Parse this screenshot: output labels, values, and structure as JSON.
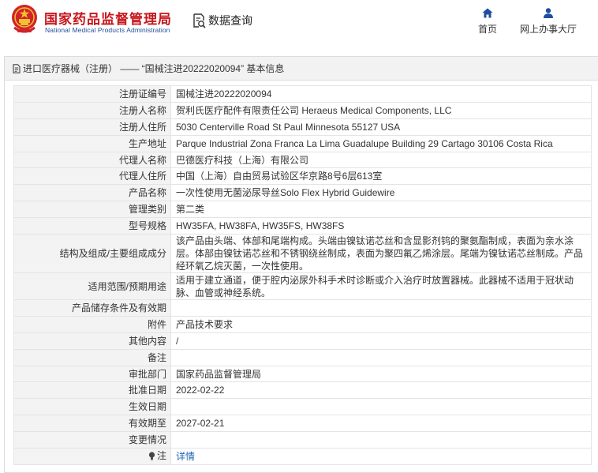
{
  "header": {
    "logo_cn": "国家药品监督管理局",
    "logo_en": "National Medical Products Administration",
    "search_label": "数据查询",
    "nav": [
      {
        "label": "首页",
        "icon": "home-icon"
      },
      {
        "label": "网上办事大厅",
        "icon": "user-icon"
      }
    ]
  },
  "panel": {
    "title": "进口医疗器械（注册） —— “国械注进20222020094” 基本信息",
    "rows": [
      {
        "label": "注册证编号",
        "value": "国械注进20222020094"
      },
      {
        "label": "注册人名称",
        "value": "贺利氏医疗配件有限责任公司 Heraeus Medical Components, LLC"
      },
      {
        "label": "注册人住所",
        "value": "5030 Centerville Road St Paul Minnesota 55127 USA"
      },
      {
        "label": "生产地址",
        "value": "Parque Industrial Zona Franca La Lima Guadalupe Building 29 Cartago 30106 Costa Rica"
      },
      {
        "label": "代理人名称",
        "value": "巴德医疗科技（上海）有限公司"
      },
      {
        "label": "代理人住所",
        "value": "中国（上海）自由贸易试验区华京路8号6层613室"
      },
      {
        "label": "产品名称",
        "value": "一次性使用无菌泌尿导丝Solo Flex Hybrid Guidewire"
      },
      {
        "label": "管理类别",
        "value": "第二类"
      },
      {
        "label": "型号规格",
        "value": "HW35FA, HW38FA, HW35FS, HW38FS"
      },
      {
        "label": "结构及组成/主要组成成分",
        "value": "该产品由头端、体部和尾端构成。头端由镍钛诺芯丝和含显影剂钨的聚氨酯制成，表面为亲水涂层。体部由镍钛诺芯丝和不锈钢绕丝制成，表面为聚四氟乙烯涂层。尾端为镍钛诺芯丝制成。产品经环氧乙烷灭菌，一次性使用。"
      },
      {
        "label": "适用范围/预期用途",
        "value": "适用于建立通道，便于腔内泌尿外科手术时诊断或介入治疗时放置器械。此器械不适用于冠状动脉、血管或神经系统。"
      },
      {
        "label": "产品储存条件及有效期",
        "value": ""
      },
      {
        "label": "附件",
        "value": "产品技术要求"
      },
      {
        "label": "其他内容",
        "value": "/"
      },
      {
        "label": "备注",
        "value": ""
      },
      {
        "label": "审批部门",
        "value": "国家药品监督管理局"
      },
      {
        "label": "批准日期",
        "value": "2022-02-22"
      },
      {
        "label": "生效日期",
        "value": ""
      },
      {
        "label": "有效期至",
        "value": "2027-02-21"
      },
      {
        "label": "变更情况",
        "value": ""
      }
    ],
    "note": {
      "label": "注",
      "link": "详情",
      "icon": "lightbulb-icon"
    }
  }
}
